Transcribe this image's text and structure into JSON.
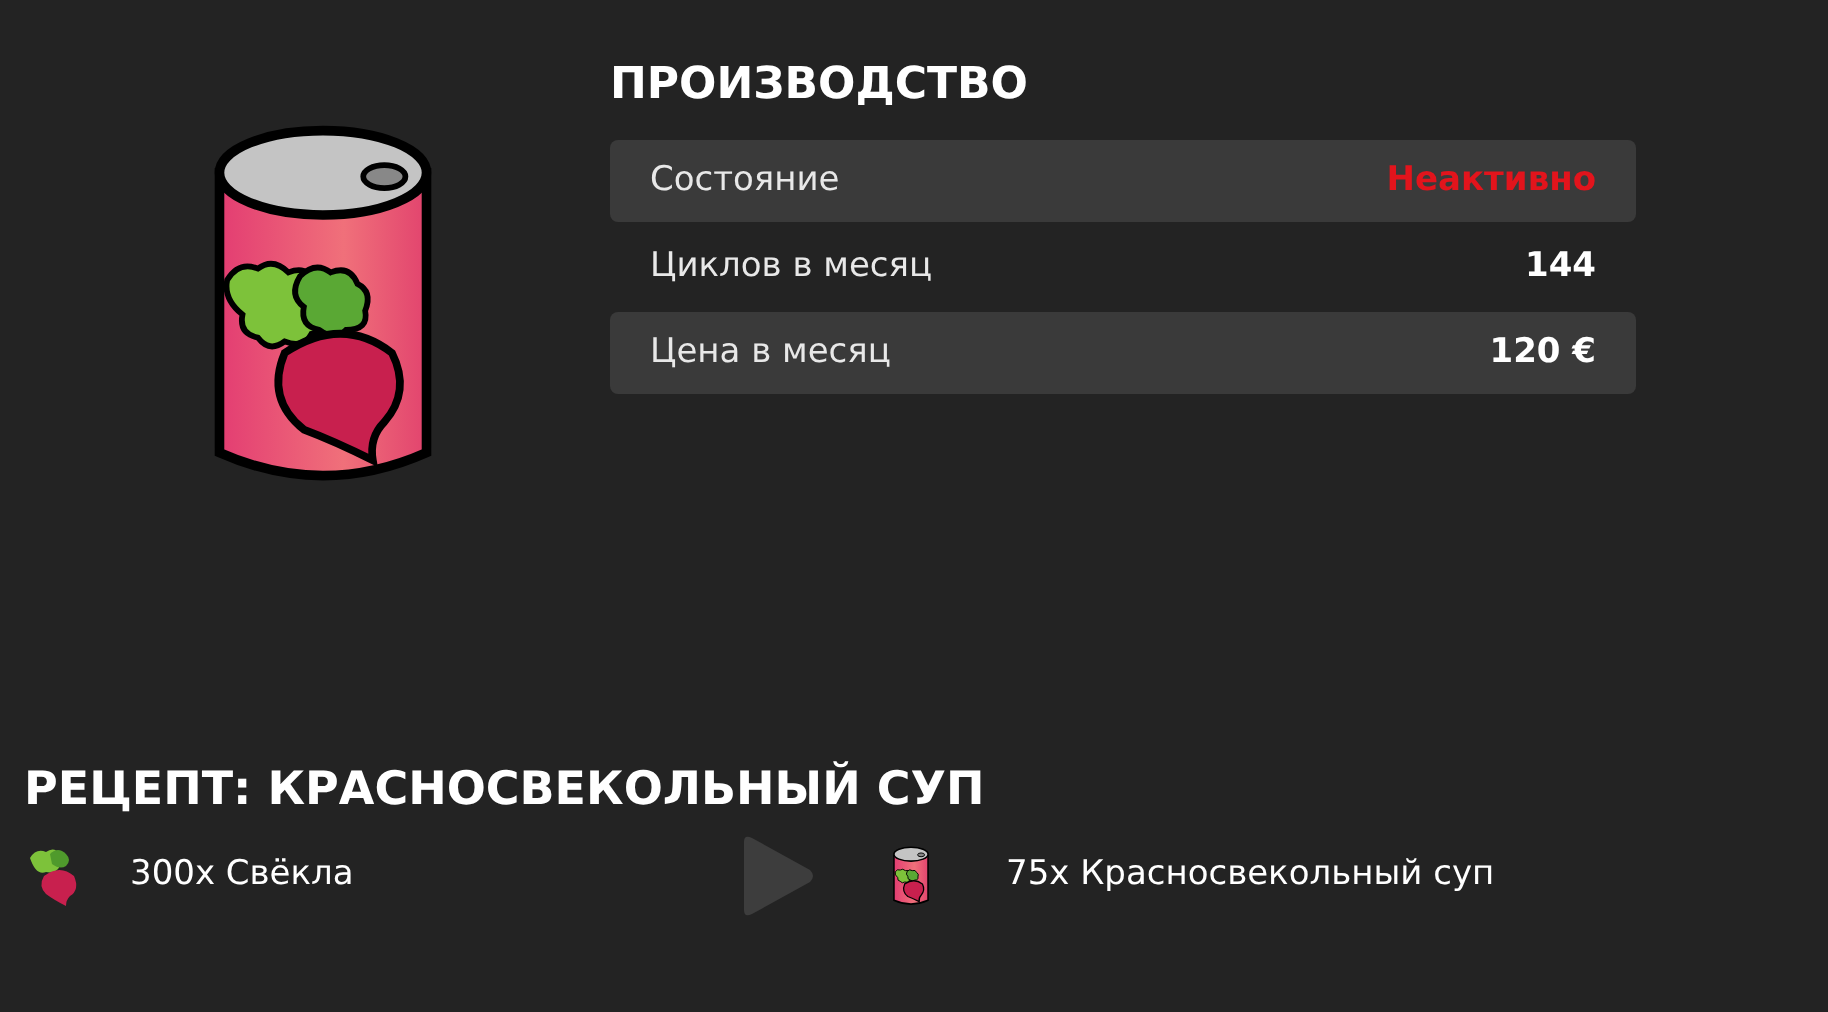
{
  "production": {
    "title": "ПРОИЗВОДСТВО",
    "stats": [
      {
        "label": "Состояние",
        "value": "Неактивно",
        "kind": "status",
        "active": false
      },
      {
        "label": "Циклов в месяц",
        "value": "144",
        "kind": "plain"
      },
      {
        "label": "Цена в месяц",
        "value": "120 €",
        "kind": "plain"
      }
    ]
  },
  "recipe": {
    "title": "РЕЦЕПТ: КРАСНОСВЕКОЛЬНЫЙ СУП",
    "input": {
      "text": "300x Свёкла",
      "kind": "beet"
    },
    "output": {
      "text": "75x Красносвекольный суп",
      "kind": "can"
    }
  }
}
